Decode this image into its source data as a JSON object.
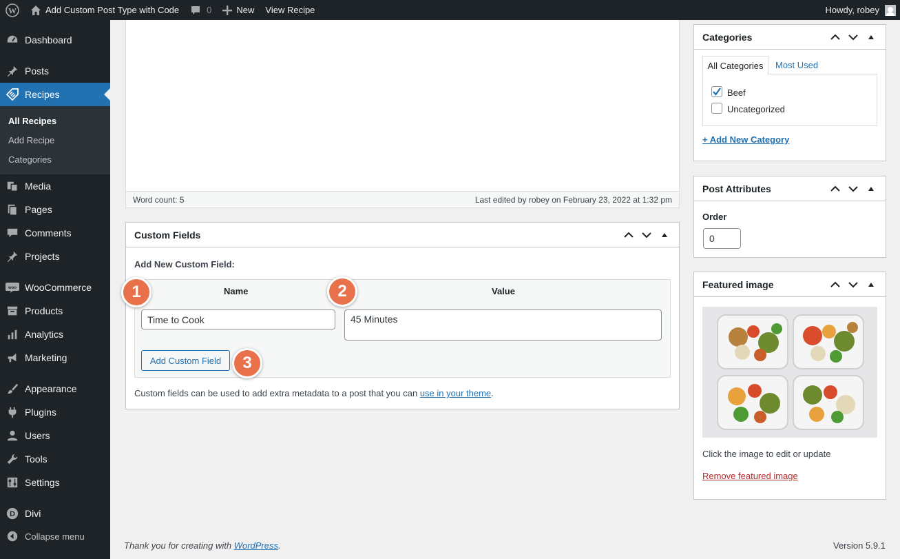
{
  "adminbar": {
    "site_name": "Add Custom Post Type with Code",
    "comments_count": "0",
    "new_label": "New",
    "view_label": "View Recipe",
    "howdy": "Howdy, robey"
  },
  "sidebar": {
    "items": [
      {
        "label": "Dashboard",
        "icon": "dashboard-icon"
      },
      {
        "label": "Posts",
        "icon": "pin-icon"
      },
      {
        "label": "Recipes",
        "icon": "tag-icon"
      },
      {
        "label": "Media",
        "icon": "media-icon"
      },
      {
        "label": "Pages",
        "icon": "pages-icon"
      },
      {
        "label": "Comments",
        "icon": "comment-icon"
      },
      {
        "label": "Projects",
        "icon": "pin-icon"
      },
      {
        "label": "WooCommerce",
        "icon": "woo-icon"
      },
      {
        "label": "Products",
        "icon": "archive-icon"
      },
      {
        "label": "Analytics",
        "icon": "bar-chart-icon"
      },
      {
        "label": "Marketing",
        "icon": "megaphone-icon"
      },
      {
        "label": "Appearance",
        "icon": "brush-icon"
      },
      {
        "label": "Plugins",
        "icon": "plug-icon"
      },
      {
        "label": "Users",
        "icon": "user-icon"
      },
      {
        "label": "Tools",
        "icon": "wrench-icon"
      },
      {
        "label": "Settings",
        "icon": "settings-icon"
      },
      {
        "label": "Divi",
        "icon": "divi-icon"
      },
      {
        "label": "Collapse menu",
        "icon": "collapse-icon"
      }
    ],
    "submenu": [
      "All Recipes",
      "Add Recipe",
      "Categories"
    ]
  },
  "editor": {
    "word_count": "Word count: 5",
    "last_edited": "Last edited by robey on February 23, 2022 at 1:32 pm"
  },
  "custom_fields": {
    "title": "Custom Fields",
    "add_new_label": "Add New Custom Field:",
    "name_header": "Name",
    "value_header": "Value",
    "name_value": "Time to Cook",
    "value_value": "45 Minutes",
    "add_button": "Add Custom Field",
    "help_prefix": "Custom fields can be used to add extra metadata to a post that you can ",
    "help_link": "use in your theme",
    "help_suffix": "."
  },
  "badges": [
    "1",
    "2",
    "3"
  ],
  "categories": {
    "title": "Categories",
    "tab_all": "All Categories",
    "tab_used": "Most Used",
    "items": [
      {
        "label": "Beef",
        "checked": true
      },
      {
        "label": "Uncategorized",
        "checked": false
      }
    ],
    "add_new": "+ Add New Category"
  },
  "post_attributes": {
    "title": "Post Attributes",
    "order_label": "Order",
    "order_value": "0"
  },
  "featured_image": {
    "title": "Featured image",
    "hint": "Click the image to edit or update",
    "remove": "Remove featured image"
  },
  "footer": {
    "thanks_prefix": "Thank you for creating with ",
    "thanks_link": "WordPress",
    "thanks_suffix": ".",
    "version": "Version 5.9.1"
  },
  "colors": {
    "accent": "#2271b1",
    "sidebar": "#1d2327",
    "badge": "#e8704a",
    "remove_link": "#b32d2e"
  }
}
